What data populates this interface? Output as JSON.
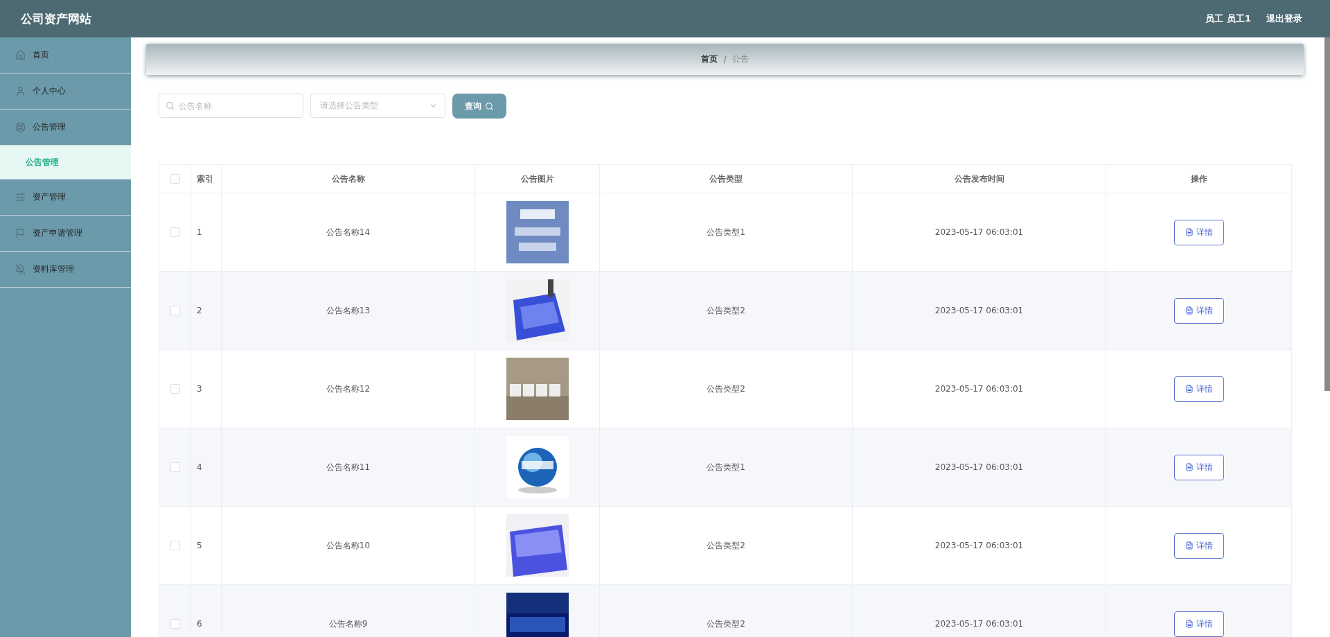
{
  "header": {
    "title": "公司资产网站",
    "user": "员工 员工1",
    "logout": "退出登录"
  },
  "sidebar": {
    "items": [
      {
        "label": "首页"
      },
      {
        "label": "个人中心",
        "expanded": false
      },
      {
        "label": "公告管理",
        "expanded": true,
        "children": [
          {
            "label": "公告管理",
            "selected": true
          }
        ]
      },
      {
        "label": "资产管理",
        "expanded": false
      },
      {
        "label": "资产申请管理",
        "expanded": false
      },
      {
        "label": "资料库管理",
        "expanded": false
      }
    ]
  },
  "breadcrumb": {
    "items": [
      "首页",
      "公告"
    ],
    "separator": "/"
  },
  "filters": {
    "search": {
      "placeholder": "公告名称"
    },
    "select": {
      "placeholder": "请选择公告类型"
    },
    "button": "查询"
  },
  "table": {
    "all_checked": false,
    "columns": [
      "索引",
      "公告名称",
      "公告图片",
      "公告类型",
      "公告发布时间",
      "操作"
    ],
    "rows": [
      {
        "index": "1",
        "name": "公告名称14",
        "type": "公告类型1",
        "time": "2023-05-17 06:03:01",
        "action": "详情",
        "checked": false
      },
      {
        "index": "2",
        "name": "公告名称13",
        "type": "公告类型2",
        "time": "2023-05-17 06:03:01",
        "action": "详情",
        "checked": false
      },
      {
        "index": "3",
        "name": "公告名称12",
        "type": "公告类型2",
        "time": "2023-05-17 06:03:01",
        "action": "详情",
        "checked": false
      },
      {
        "index": "4",
        "name": "公告名称11",
        "type": "公告类型1",
        "time": "2023-05-17 06:03:01",
        "action": "详情",
        "checked": false
      },
      {
        "index": "5",
        "name": "公告名称10",
        "type": "公告类型2",
        "time": "2023-05-17 06:03:01",
        "action": "详情",
        "checked": false
      },
      {
        "index": "6",
        "name": "公告名称9",
        "type": "公告类型2",
        "time": "2023-05-17 06:03:01",
        "action": "详情",
        "checked": false
      }
    ]
  }
}
